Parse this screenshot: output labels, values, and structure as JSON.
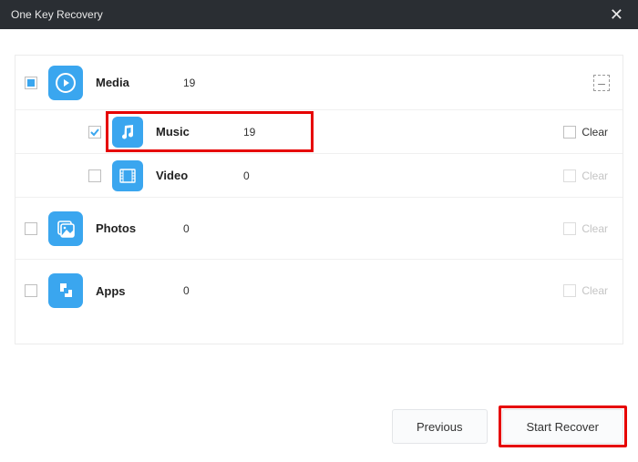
{
  "window": {
    "title": "One Key Recovery"
  },
  "categories": {
    "media": {
      "label": "Media",
      "count": "19"
    },
    "music": {
      "label": "Music",
      "count": "19",
      "clear": "Clear"
    },
    "video": {
      "label": "Video",
      "count": "0",
      "clear": "Clear"
    },
    "photos": {
      "label": "Photos",
      "count": "0",
      "clear": "Clear"
    },
    "apps": {
      "label": "Apps",
      "count": "0",
      "clear": "Clear"
    }
  },
  "collapse_glyph": "–",
  "footer": {
    "previous": "Previous",
    "start": "Start Recover"
  }
}
